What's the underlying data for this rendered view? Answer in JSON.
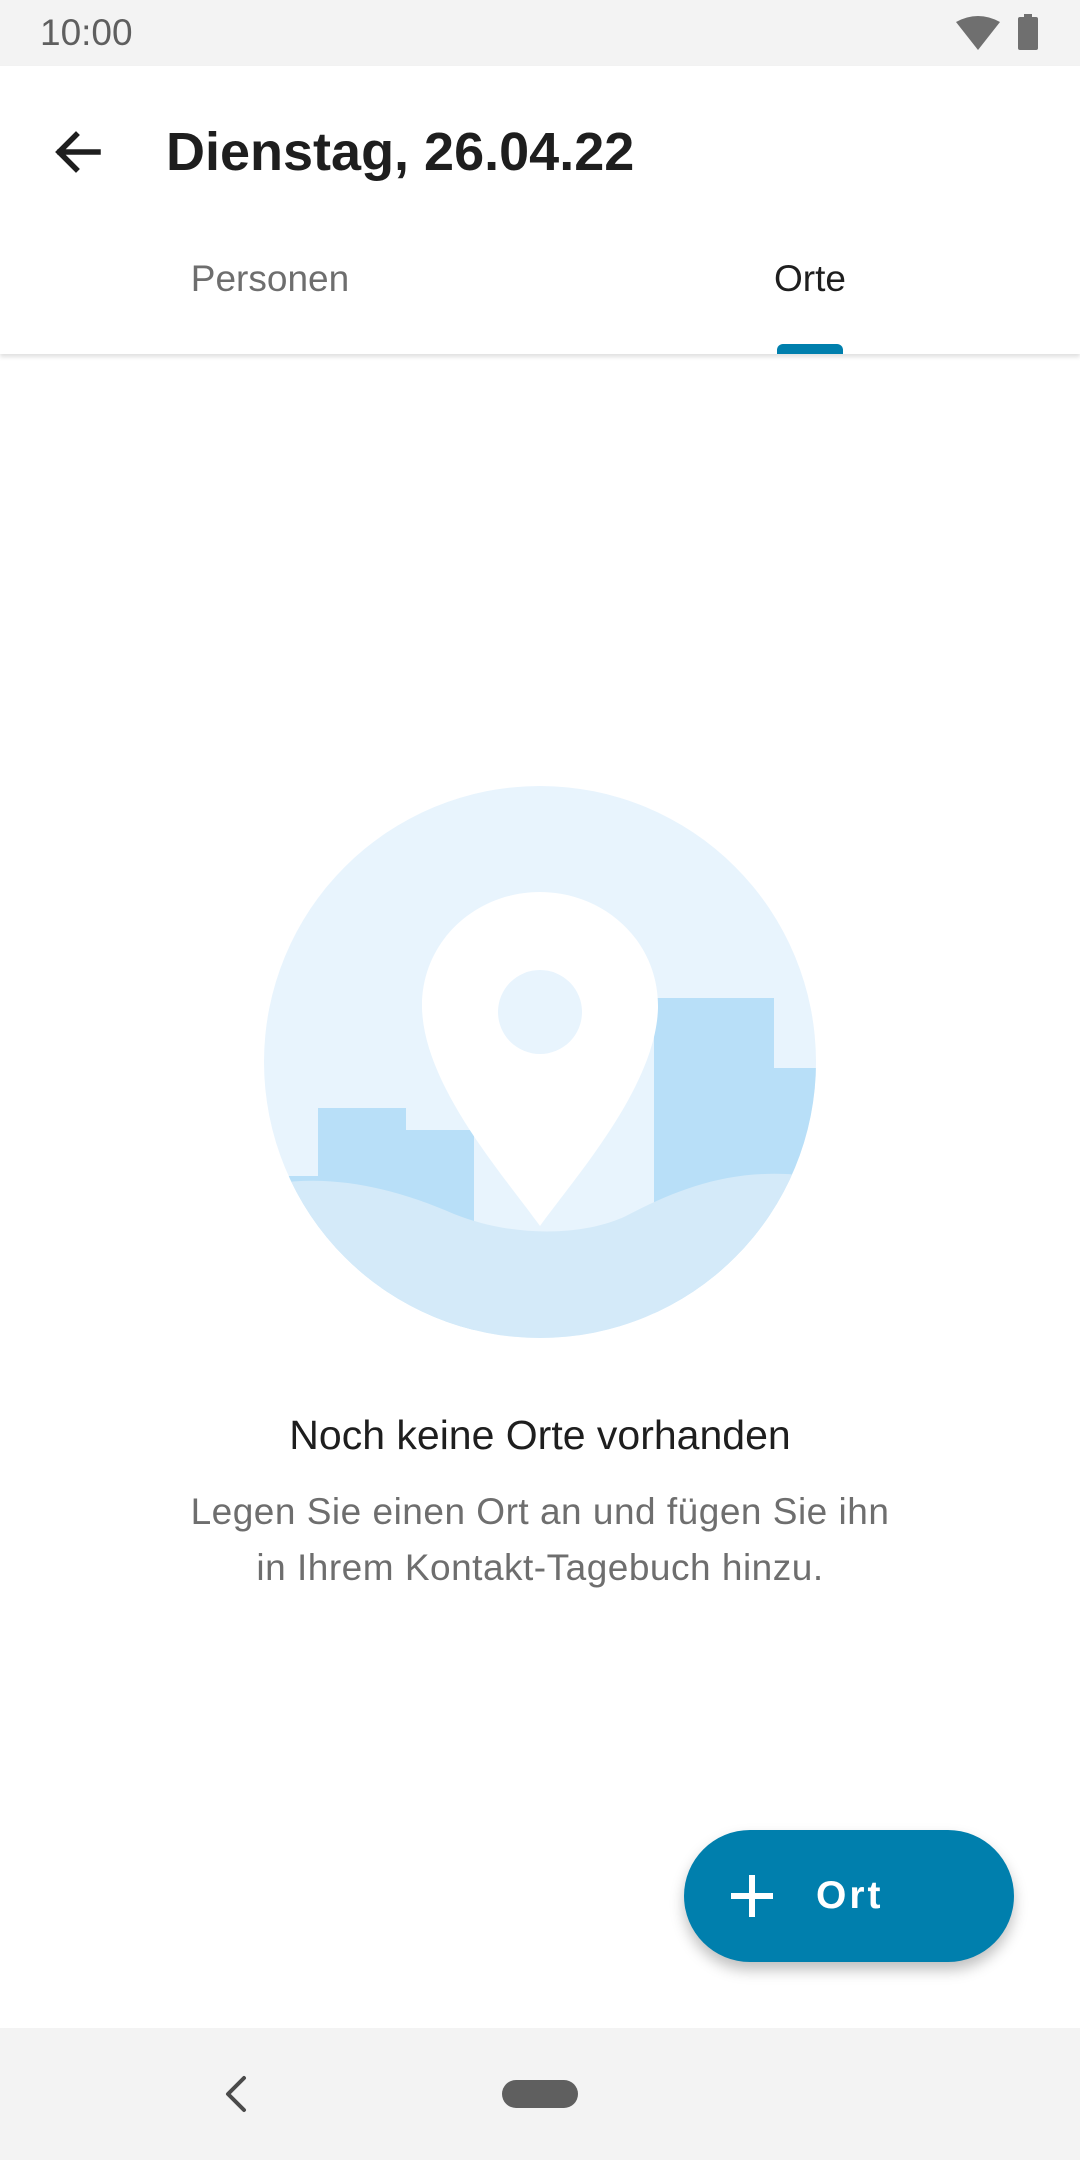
{
  "status_bar": {
    "time": "10:00",
    "icons": [
      "wifi-icon",
      "battery-icon"
    ]
  },
  "app_bar": {
    "back_icon": "arrow-back-icon",
    "title": "Dienstag, 26.04.22"
  },
  "tabs": [
    {
      "label": "Personen",
      "selected": false
    },
    {
      "label": "Orte",
      "selected": true
    }
  ],
  "empty_state": {
    "illustration_icon": "location-pin-icon",
    "title": "Noch keine Orte vorhanden",
    "text_line1": "Legen Sie einen Ort an und fügen Sie ihn",
    "text_line2": "in Ihrem Kontakt-Tagebuch hinzu."
  },
  "fab": {
    "icon": "plus-icon",
    "label": "Ort"
  },
  "nav_bar": {
    "icons": [
      "nav-back-icon",
      "nav-home-pill"
    ]
  },
  "colors": {
    "accent": "#007fad",
    "title_text": "#1e1e1e",
    "secondary_text": "#6e6e6e",
    "illustration_light": "#e8f4fd",
    "illustration_mid": "#b8dff8",
    "illustration_ground": "#d4eaf9"
  }
}
